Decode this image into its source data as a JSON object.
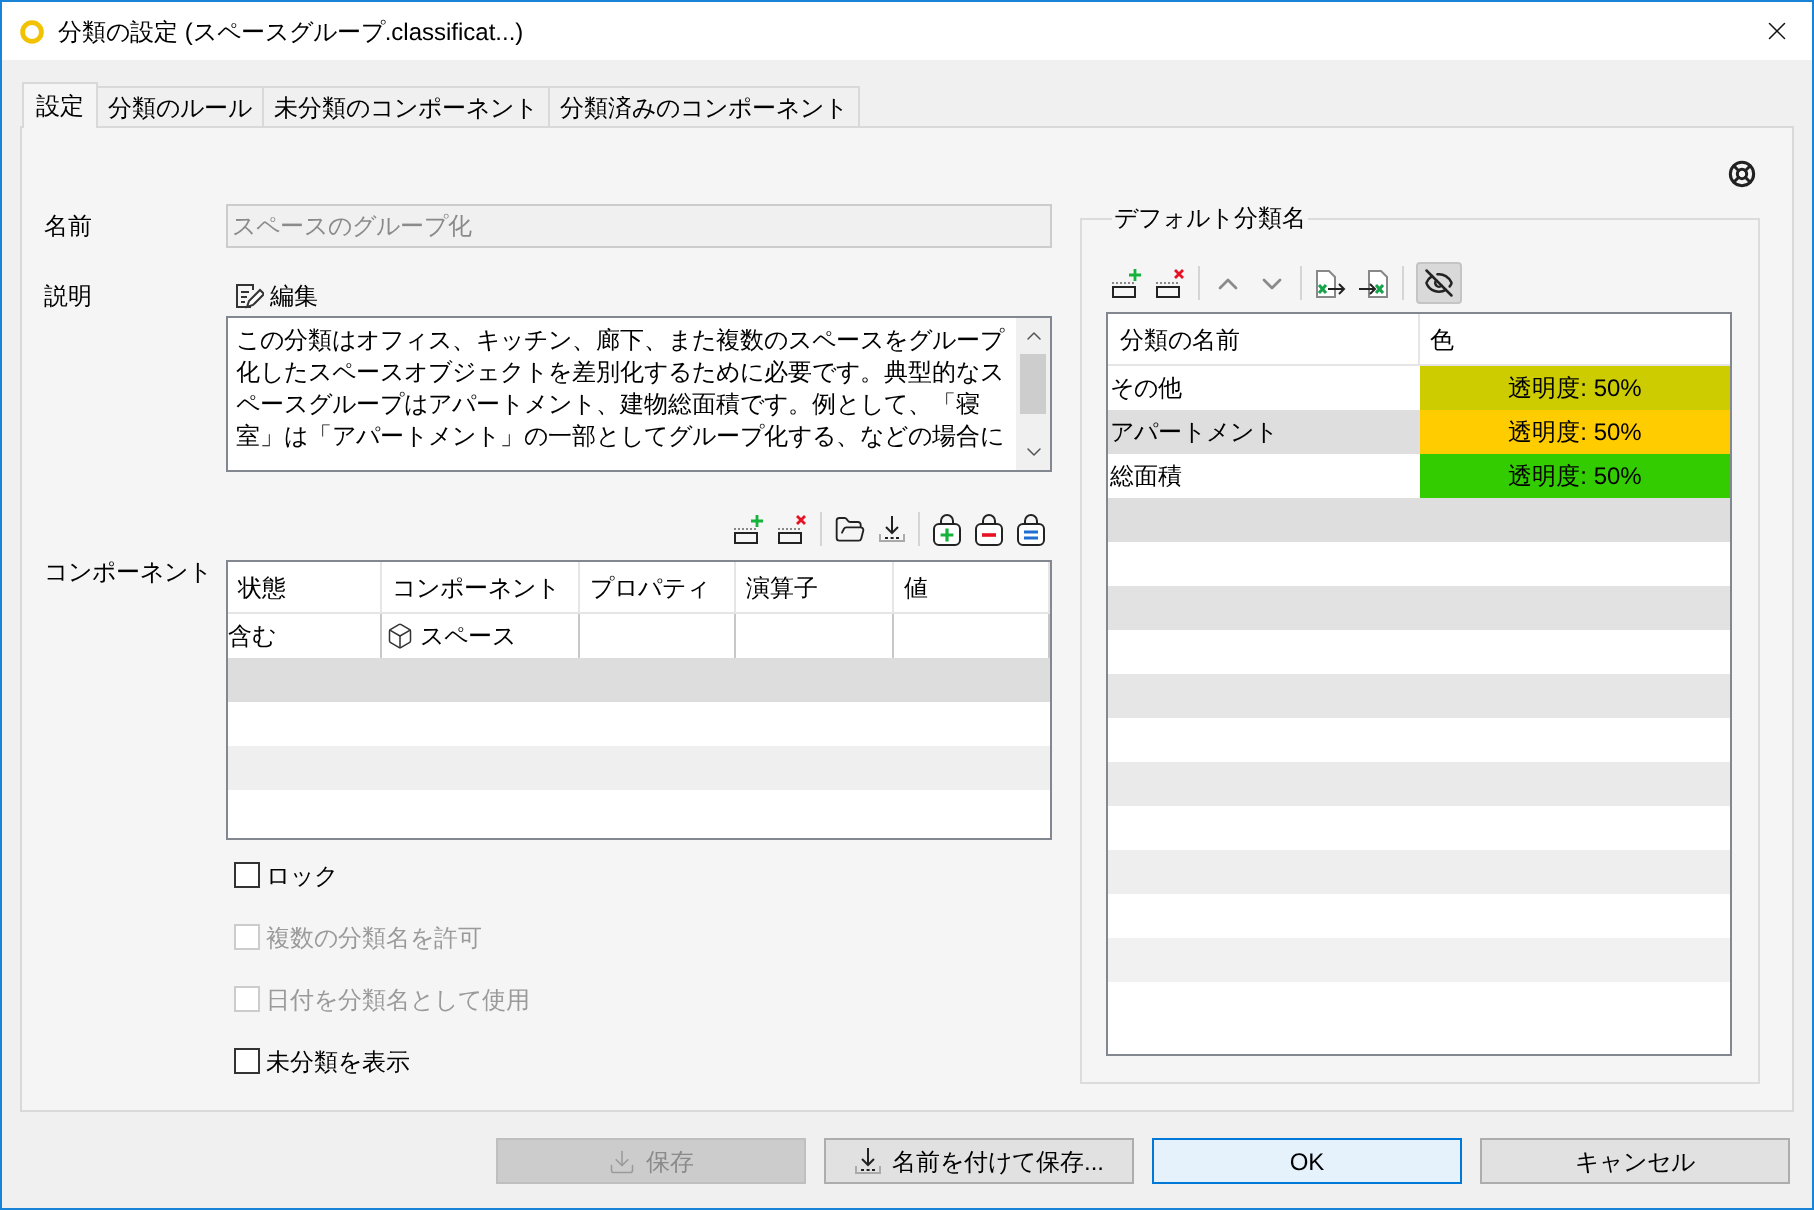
{
  "window": {
    "title": "分類の設定 (スペースグループ.classificat...)"
  },
  "tabs": [
    {
      "label": "設定",
      "selected": true
    },
    {
      "label": "分類のルール",
      "selected": false
    },
    {
      "label": "未分類のコンポーネント",
      "selected": false
    },
    {
      "label": "分類済みのコンポーネント",
      "selected": false
    }
  ],
  "name": {
    "label": "名前",
    "value": "スペースのグループ化",
    "disabled": true
  },
  "description": {
    "label": "説明",
    "edit_button": "編集",
    "text": "この分類はオフィス、キッチン、廊下、また複数のスペースをグループ化したスペースオブジェクトを差別化するために必要です。典型的なスペースグループはアパートメント、建物総面積です。例として、「寝室」は「アパートメント」の一部としてグループ化する、などの場合に"
  },
  "components": {
    "label": "コンポーネント",
    "columns": [
      "状態",
      "コンポーネント",
      "プロパティ",
      "演算子",
      "値"
    ],
    "rows": [
      {
        "state": "含む",
        "component": "スペース"
      }
    ]
  },
  "options": [
    {
      "label": "ロック",
      "checked": false,
      "disabled": false
    },
    {
      "label": "複数の分類名を許可",
      "checked": false,
      "disabled": true
    },
    {
      "label": "日付を分類名として使用",
      "checked": false,
      "disabled": true
    },
    {
      "label": "未分類を表示",
      "checked": false,
      "disabled": false
    }
  ],
  "default_names": {
    "title": "デフォルト分類名",
    "hide_toggle_on": true,
    "columns": [
      "分類の名前",
      "色"
    ],
    "rows": [
      {
        "name": "その他",
        "color": "#cccc00",
        "opacity": "透明度: 50%"
      },
      {
        "name": "アパートメント",
        "color": "#ffcc00",
        "opacity": "透明度: 50%"
      },
      {
        "name": "総面積",
        "color": "#33cc00",
        "opacity": "透明度: 50%"
      }
    ]
  },
  "buttons": [
    {
      "label": "保存",
      "kind": "save",
      "disabled": true
    },
    {
      "label": "名前を付けて保存...",
      "kind": "save_as",
      "disabled": false
    },
    {
      "label": "OK",
      "kind": "default",
      "disabled": false
    },
    {
      "label": "キャンセル",
      "kind": "cancel",
      "disabled": false
    }
  ]
}
